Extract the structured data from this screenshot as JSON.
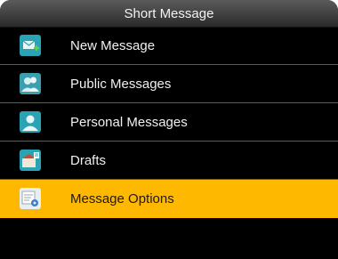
{
  "header": {
    "title": "Short Message"
  },
  "menu": {
    "items": [
      {
        "label": "New Message",
        "icon": "new-message-icon",
        "selected": false
      },
      {
        "label": "Public Messages",
        "icon": "public-messages-icon",
        "selected": false
      },
      {
        "label": "Personal Messages",
        "icon": "personal-message-icon",
        "selected": false
      },
      {
        "label": "Drafts",
        "icon": "drafts-icon",
        "selected": false
      },
      {
        "label": "Message Options",
        "icon": "message-options-icon",
        "selected": true
      }
    ]
  },
  "colors": {
    "selected_bg": "#ffb800",
    "screen_bg": "#000000"
  }
}
